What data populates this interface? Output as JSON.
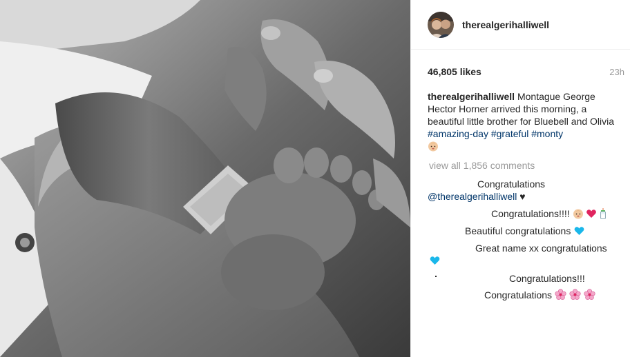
{
  "post": {
    "username": "therealgerihalliwell",
    "likes": "46,805 likes",
    "time": "23h"
  },
  "caption": {
    "username": "therealgerihalliwell",
    "text": "Montague George Hector Horner arrived this morning, a beautiful little brother for Bluebell and Olivia",
    "hashtags": [
      "#amazing-day",
      "#grateful",
      "#monty"
    ]
  },
  "comments": {
    "view_all": "view all 1,856 comments",
    "items": [
      {
        "text": "Congratulations"
      },
      {
        "mention": "@therealgerihalliwell",
        "suffix": "♥"
      },
      {
        "text": "Congratulations!!!!"
      },
      {
        "text": "Beautiful congratulations"
      },
      {
        "text": "Great name xx congratulations"
      },
      {
        "text": "Congratulations!!!"
      },
      {
        "text": "Congratulations"
      }
    ]
  },
  "icons": {
    "baby_face": "baby-emoji-icon",
    "red_heart": "red-heart-emoji-icon",
    "blue_heart": "blue-heart-emoji-icon",
    "bottle": "baby-bottle-emoji-icon",
    "blossom": "cherry-blossom-emoji-icon"
  },
  "colors": {
    "hashtag": "#003569",
    "muted": "#999999",
    "blue_heart": "#1ab7ea",
    "red_heart": "#e0245e",
    "blossom": "#f4a7c9"
  }
}
